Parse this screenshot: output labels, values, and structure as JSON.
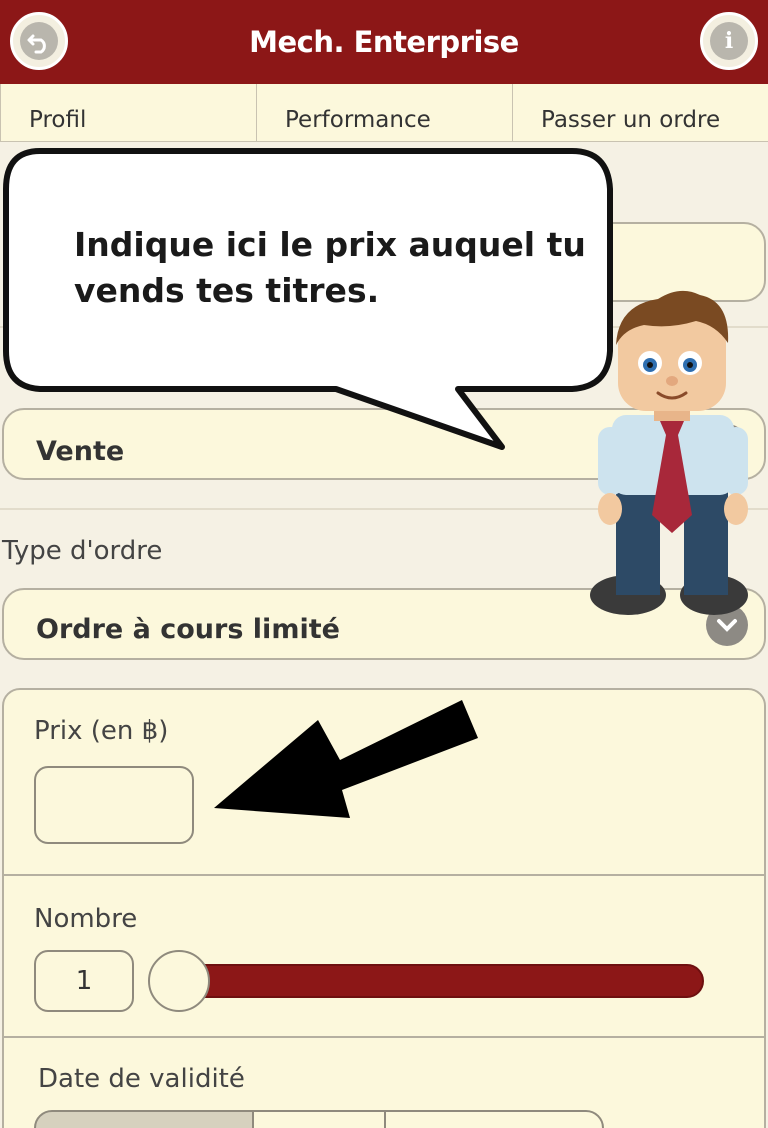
{
  "header": {
    "title": "Mech. Enterprise",
    "back_icon": "back-arrow-icon",
    "info_icon": "info-icon"
  },
  "tabs": [
    {
      "label": "Profil"
    },
    {
      "label": "Performance"
    },
    {
      "label": "Passer un ordre"
    }
  ],
  "tutorial": {
    "bubble_text": "Indique ici le prix auquel tu vends tes titres."
  },
  "form": {
    "transaction": {
      "value": "Vente"
    },
    "order_type": {
      "label": "Type d'ordre",
      "value": "Ordre à cours limité"
    },
    "price": {
      "label": "Prix (en ฿)",
      "value": ""
    },
    "quantity": {
      "label": "Nombre",
      "value": "1",
      "slider_level": 0
    },
    "validity": {
      "label": "Date de validité"
    }
  },
  "colors": {
    "brand": "#8c1717",
    "panel": "#fcf8dc",
    "background": "#f5f1e4"
  }
}
